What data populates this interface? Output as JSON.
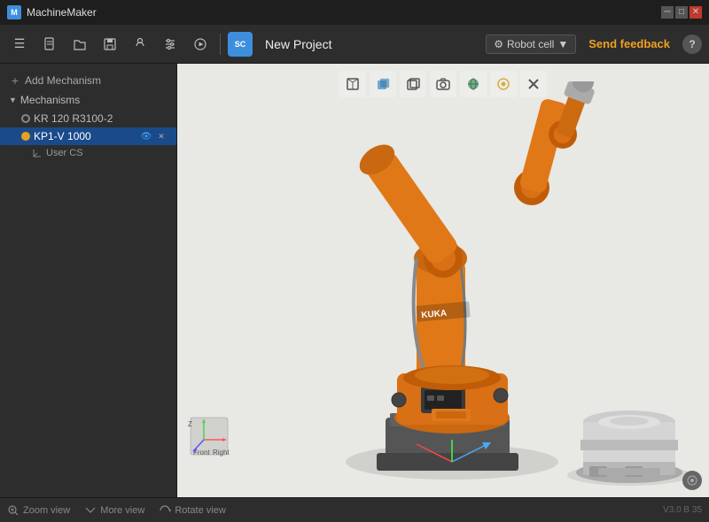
{
  "titlebar": {
    "app_name": "MachineMaker",
    "controls": [
      "─",
      "□",
      "✕"
    ]
  },
  "toolbar": {
    "project_label": "New Project",
    "robot_cell_label": "Robot cell",
    "send_feedback_label": "Send feedback",
    "help_label": "?",
    "kuka_badge": "SC"
  },
  "sidebar": {
    "add_mechanism_label": "Add Mechanism",
    "mechanisms_label": "Mechanisms",
    "items": [
      {
        "id": "kr120",
        "label": "KR 120 R3100-2",
        "selected": false
      },
      {
        "id": "kp1v1000",
        "label": "KP1-V 1000",
        "selected": true
      },
      {
        "id": "usercs",
        "label": "User CS",
        "type": "cs"
      }
    ]
  },
  "viewport_toolbar": {
    "icons": [
      {
        "name": "wireframe-cube-icon",
        "symbol": "◻",
        "title": "Wireframe"
      },
      {
        "name": "solid-cube-icon",
        "symbol": "■",
        "title": "Solid",
        "color": "#5599cc"
      },
      {
        "name": "edge-cube-icon",
        "symbol": "◧",
        "title": "Edges"
      },
      {
        "name": "camera-icon",
        "symbol": "⊡",
        "title": "Camera"
      },
      {
        "name": "sphere-icon",
        "symbol": "●",
        "title": "Sphere",
        "color": "#5a9a70"
      },
      {
        "name": "dot-circle-icon",
        "symbol": "◉",
        "title": "Dot",
        "color": "#ddaa44"
      },
      {
        "name": "cross-icon",
        "symbol": "✕",
        "title": "Cross"
      }
    ]
  },
  "bottom_bar": {
    "zoom_label": "Zoom view",
    "more_label": "More view",
    "rotate_label": "Rotate view",
    "version": "V3.0 B 35"
  },
  "axis_labels": {
    "z": "Z",
    "front": "Front",
    "right": "Right"
  }
}
